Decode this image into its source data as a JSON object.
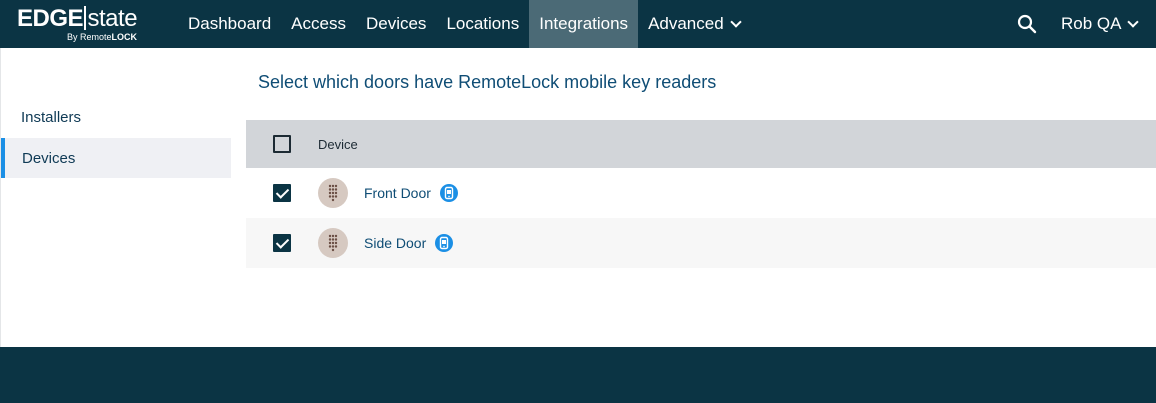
{
  "brand": {
    "edge": "EDGE",
    "state": "state",
    "by_prefix": "By Remote",
    "by_suffix": "LOCK"
  },
  "nav": {
    "items": [
      {
        "label": "Dashboard"
      },
      {
        "label": "Access"
      },
      {
        "label": "Devices"
      },
      {
        "label": "Locations"
      },
      {
        "label": "Integrations"
      },
      {
        "label": "Advanced"
      }
    ],
    "active": "Integrations",
    "user": "Rob QA"
  },
  "sidebar": {
    "items": [
      {
        "label": "Installers"
      },
      {
        "label": "Devices"
      }
    ],
    "active": "Devices"
  },
  "main": {
    "heading": "Select which doors have RemoteLock mobile key readers",
    "table": {
      "column": "Device",
      "select_all_checked": false,
      "rows": [
        {
          "name": "Front Door",
          "checked": true
        },
        {
          "name": "Side Door",
          "checked": true
        }
      ]
    }
  },
  "colors": {
    "topbar": "#0b3444",
    "active_nav": "#4b6a76",
    "accent": "#1b8fe5",
    "link": "#0f4d75"
  },
  "icons": {
    "search": "search-icon",
    "dropdown": "chevron-down-icon",
    "device": "keypad-icon",
    "mobile_key": "mobile-key-icon"
  }
}
